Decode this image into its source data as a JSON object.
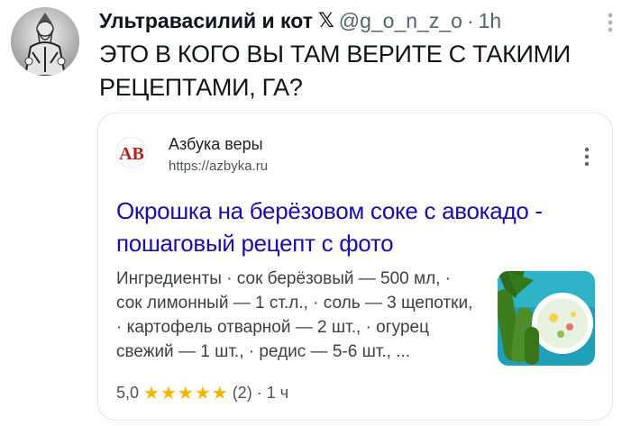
{
  "tweet": {
    "author": "Ультравасилий и кот",
    "badge": "𝕏",
    "handle": "@g_o_n_z_o",
    "separator": "·",
    "time": "1h",
    "text": "ЭТО В КОГО ВЫ ТАМ ВЕРИТЕ С ТАКИМИ РЕЦЕПТАМИ, ГА?"
  },
  "card": {
    "favicon_letters": "АВ",
    "site_name": "Азбука веры",
    "site_url": "https://azbyka.ru",
    "title": "Окрошка на берёзовом соке с авокадо - пошаговый рецепт с фото",
    "snippet": "Ингредиенты · сок берёзовый — 500 мл, · сок лимонный — 1 ст.л., · соль — 3 щепотки, · картофель отварной — 2 шт., · огурец свежий — 1 шт., · редис — 5-6 шт., ...",
    "rating": "5,0",
    "stars": "★★★★★",
    "reviews": "(2)",
    "separator": "·",
    "age": "1 ч"
  },
  "colors": {
    "link": "#1a0dab",
    "favicon": "#b3241c",
    "stars": "#f4b400",
    "muted": "#536471"
  },
  "icons": {
    "avatar": "avatar-icon",
    "more": "more-vertical-icon",
    "favicon": "site-favicon-icon",
    "thumbnail": "food-photo-icon"
  }
}
